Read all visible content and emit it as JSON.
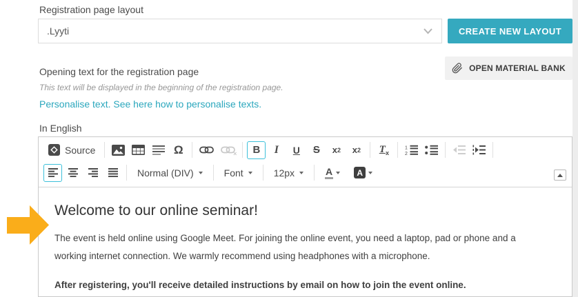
{
  "layout_section": {
    "label": "Registration page layout",
    "select_value": ".Lyyti",
    "create_button_label": "CREATE NEW LAYOUT"
  },
  "material_bank": {
    "button_label": "OPEN MATERIAL BANK",
    "icon": "paperclip-icon"
  },
  "opening_text_section": {
    "title": "Opening text for the registration page",
    "description": "This text will be displayed in the beginning of the registration page.",
    "personalise_link": "Personalise text. See here how to personalise texts.",
    "language_label": "In English"
  },
  "editor": {
    "toolbar": {
      "source_label": "Source",
      "omega": "Ω",
      "bold": "B",
      "italic": "I",
      "underline": "U",
      "strike": "S",
      "subscript_base": "x",
      "subscript_mark": "2",
      "superscript_base": "x",
      "superscript_mark": "2",
      "removeformat_base": "T",
      "removeformat_mark": "x",
      "format_value": "Normal (DIV)",
      "font_value": "Font",
      "size_value": "12px",
      "textcolor_glyph": "A",
      "bgcolor_glyph": "A",
      "active_buttons": [
        "bold",
        "align-left"
      ],
      "disabled_buttons": [
        "unlink",
        "outdent"
      ]
    },
    "content": {
      "heading": "Welcome to our online seminar!",
      "paragraph": "The event is held online using Google Meet. For joining the online event, you need a laptop, pad or phone and a working internet connection. We warmly recommend using headphones with a microphone.",
      "bold_paragraph": "After registering, you'll receive detailed instructions by email on how to join the event online."
    }
  },
  "colors": {
    "accent_teal": "#35a9bf",
    "link_teal": "#2ba7bd",
    "active_border": "#3cc0da",
    "arrow_orange": "#faad1a",
    "material_btn_bg": "#f1f1f1"
  }
}
